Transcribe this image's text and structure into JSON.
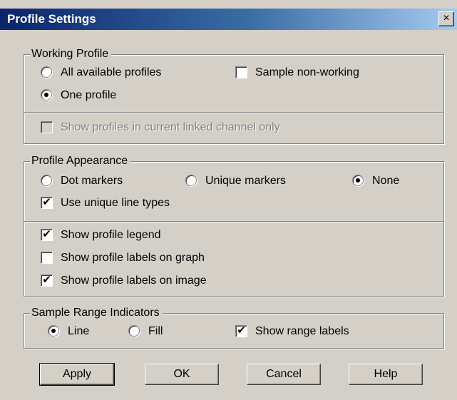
{
  "window": {
    "title": "Profile Settings",
    "close_glyph": "×"
  },
  "working_profile": {
    "legend": "Working Profile",
    "all_profiles": {
      "label": "All available profiles",
      "checked": false
    },
    "one_profile": {
      "label": "One profile",
      "checked": true
    },
    "sample_non_working": {
      "label": "Sample non-working",
      "checked": false
    },
    "linked_channel": {
      "label": "Show profiles in current linked channel only",
      "checked": false,
      "enabled": false
    }
  },
  "profile_appearance": {
    "legend": "Profile Appearance",
    "dot_markers": {
      "label": "Dot markers",
      "checked": false
    },
    "unique_markers": {
      "label": "Unique markers",
      "checked": false
    },
    "none": {
      "label": "None",
      "checked": true
    },
    "unique_line_types": {
      "label": "Use unique line types",
      "checked": true
    },
    "show_legend": {
      "label": "Show profile legend",
      "checked": true
    },
    "labels_on_graph": {
      "label": "Show profile labels on graph",
      "checked": false
    },
    "labels_on_image": {
      "label": "Show profile labels on image",
      "checked": true
    }
  },
  "sample_range": {
    "legend": "Sample Range Indicators",
    "line": {
      "label": "Line",
      "checked": true
    },
    "fill": {
      "label": "Fill",
      "checked": false
    },
    "range_labels": {
      "label": "Show range labels",
      "checked": true
    }
  },
  "buttons": {
    "apply": "Apply",
    "ok": "OK",
    "cancel": "Cancel",
    "help": "Help"
  },
  "check_glyph": "✔"
}
